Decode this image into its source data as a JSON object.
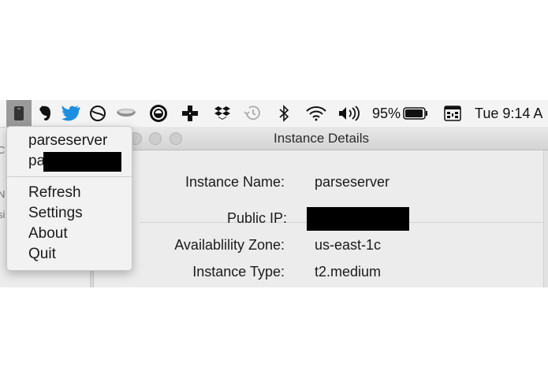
{
  "menubar": {
    "battery_percent": "95%",
    "clock": "Tue 9:14 A",
    "icons": [
      "app-icon",
      "evernote-icon",
      "twitter-icon",
      "circle-slash-icon",
      "bowl-icon",
      "round-app-icon",
      "cross-icon",
      "dropbox-icon",
      "time-machine-icon",
      "bluetooth-icon",
      "wifi-icon",
      "volume-icon",
      "battery-icon",
      "menu-extra-icon"
    ]
  },
  "menu": {
    "items": [
      "parseserver",
      "pa",
      "Refresh",
      "Settings",
      "About",
      "Quit"
    ]
  },
  "window": {
    "title": "Instance Details",
    "instance_name_label": "Instance Name:",
    "instance_name_value": "parseserver",
    "public_ip_label": "Public IP:",
    "zone_label": "Availablility Zone:",
    "zone_value": "us-east-1c",
    "type_label": "Instance Type:",
    "type_value": "t2.medium"
  },
  "backdrop": {
    "left_fragments": [
      "C",
      "si",
      "N"
    ]
  }
}
